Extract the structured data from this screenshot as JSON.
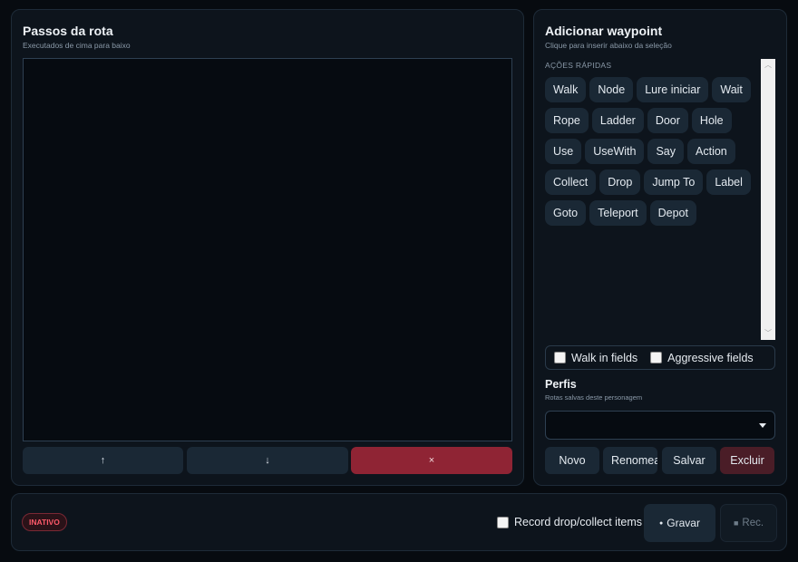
{
  "steps_panel": {
    "title": "Passos da rota",
    "subtitle": "Executados de cima para baixo",
    "up_label": "↑",
    "down_label": "↓",
    "delete_label": "×"
  },
  "waypoint_panel": {
    "title": "Adicionar waypoint",
    "subtitle": "Clique para inserir abaixo da seleção",
    "quick_actions_label": "AÇÕES RÁPIDAS",
    "quick_actions": [
      "Walk",
      "Node",
      "Lure iniciar",
      "Wait",
      "Rope",
      "Ladder",
      "Door",
      "Hole",
      "Use",
      "UseWith",
      "Say",
      "Action",
      "Collect",
      "Drop",
      "Jump To",
      "Label",
      "Goto",
      "Teleport",
      "Depot"
    ],
    "walk_in_fields": "Walk in fields",
    "aggressive_fields": "Aggressive fields",
    "profiles_title": "Perfis",
    "profiles_subtitle": "Rotas salvas deste personagem",
    "profile_selected": "",
    "novo": "Novo",
    "renomear": "Renomear",
    "salvar": "Salvar",
    "excluir": "Excluir"
  },
  "bottom_bar": {
    "status": "INATIVO",
    "record_label": "Record drop/collect items",
    "gravar": "Gravar",
    "gravar_icon": "●",
    "rec": "Rec.",
    "rec_icon": "■"
  },
  "colors": {
    "background": "#070b10",
    "panel": "#0d141c",
    "button": "#1a2835",
    "danger": "#8f2434",
    "status_red": "#ff5a6a"
  }
}
